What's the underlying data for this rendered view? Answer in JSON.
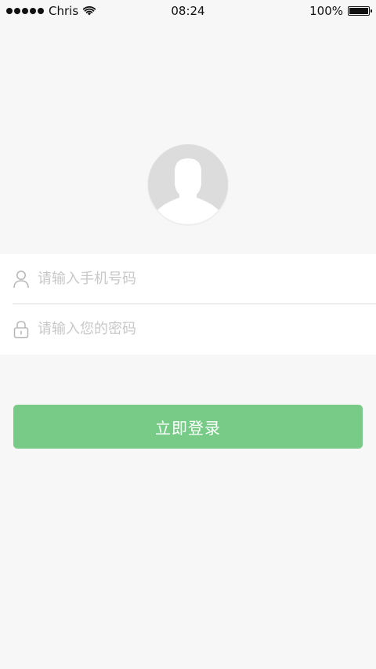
{
  "status_bar": {
    "carrier": "Chris",
    "time": "08:24",
    "battery": "100%",
    "battery_level": 100
  },
  "form": {
    "phone_placeholder": "请输入手机号码",
    "phone_value": "",
    "password_placeholder": "请输入您的密码",
    "password_value": ""
  },
  "actions": {
    "login_label": "立即登录"
  },
  "colors": {
    "primary_button": "#77cb87",
    "background": "#f7f7f7",
    "card": "#ffffff",
    "divider": "#dcdcdc",
    "placeholder": "#c8c8c8",
    "avatar_bg": "#dcdcdc"
  },
  "icons": {
    "signal": "signal-icon",
    "wifi": "wifi-icon",
    "battery": "battery-icon",
    "avatar": "user-avatar-icon",
    "phone_field": "user-icon",
    "password_field": "lock-icon"
  }
}
